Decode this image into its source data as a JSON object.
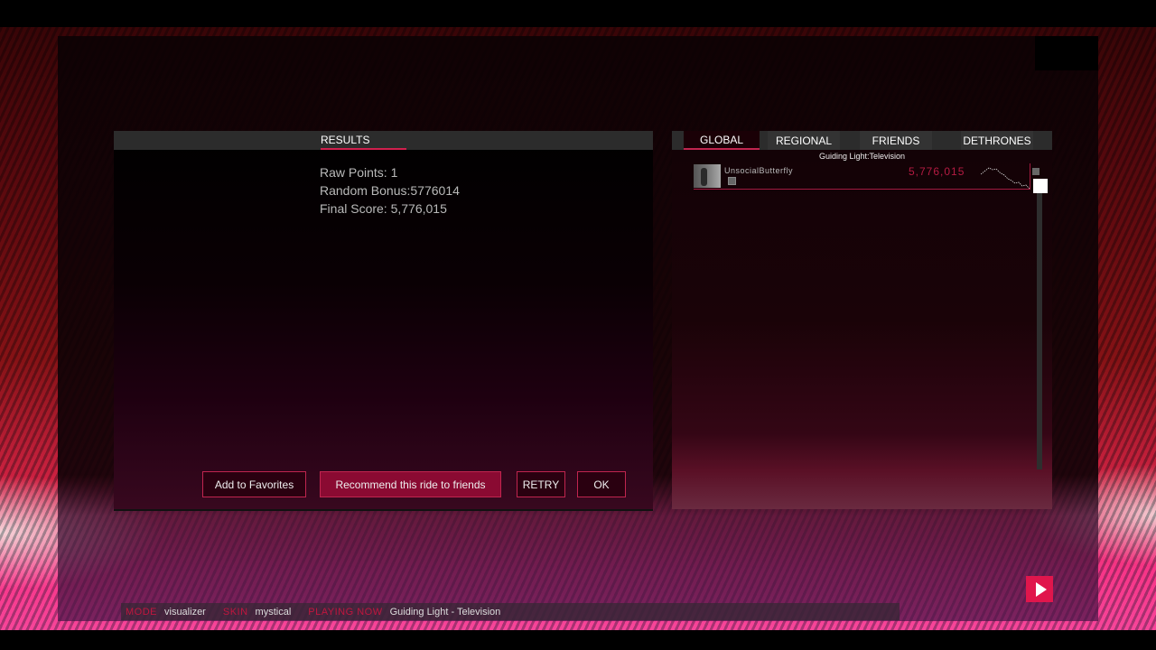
{
  "results": {
    "tab_label": "RESULTS",
    "lines": [
      "Raw Points: 1",
      "Random Bonus:5776014",
      "Final Score: 5,776,015"
    ],
    "buttons": {
      "add_favorites": "Add to Favorites",
      "recommend": "Recommend this ride to friends",
      "retry": "RETRY",
      "ok": "OK"
    }
  },
  "leaderboard": {
    "tabs": [
      "GLOBAL",
      "REGIONAL",
      "FRIENDS",
      "DETHRONES"
    ],
    "active_tab": "GLOBAL",
    "song_title": "Guiding Light:Television",
    "entries": [
      {
        "name": "UnsocialButterfly",
        "score": "5,776,015"
      }
    ]
  },
  "status_bar": {
    "mode_label": "MODE",
    "mode_value": "visualizer",
    "skin_label": "SKIN",
    "skin_value": "mystical",
    "playing_label": "PLAYING NOW",
    "playing_value": "Guiding Light - Television"
  },
  "colors": {
    "accent": "#c0254f",
    "score": "#b51b42",
    "play": "#e0164c"
  }
}
